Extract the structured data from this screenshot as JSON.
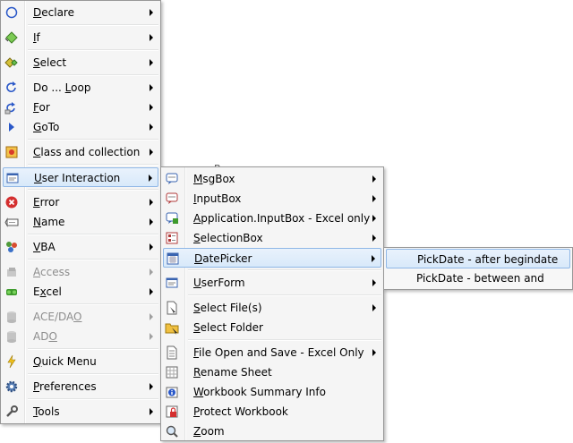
{
  "main_menu": {
    "items": [
      {
        "label": "Declare",
        "mnemonic": "D",
        "rest": "eclare",
        "icon": "circle-icon"
      },
      {
        "label": "If",
        "mnemonic": "I",
        "rest": "f",
        "icon": "diamond-green-icon"
      },
      {
        "label": "Select",
        "mnemonic": "S",
        "rest": "elect",
        "icon": "diamond-yellow-icon"
      },
      {
        "label": "Do ... Loop",
        "pre": "Do ... ",
        "mnemonic": "L",
        "rest": "oop",
        "icon": "loop-icon"
      },
      {
        "label": "For",
        "mnemonic": "F",
        "rest": "or",
        "icon": "for-loop-icon"
      },
      {
        "label": "GoTo",
        "mnemonic": "G",
        "rest": "oTo",
        "icon": "play-arrow-icon"
      },
      {
        "label": "Class and collection",
        "mnemonic": "C",
        "rest": "lass and collection",
        "icon": "class-icon"
      },
      {
        "label": "User Interaction",
        "mnemonic": "U",
        "rest": "ser Interaction",
        "icon": "form-icon"
      },
      {
        "label": "Error",
        "mnemonic": "E",
        "rest": "rror",
        "icon": "error-icon"
      },
      {
        "label": "Name",
        "mnemonic": "N",
        "rest": "ame",
        "icon": "name-tag-icon"
      },
      {
        "label": "VBA",
        "mnemonic": "V",
        "rest": "BA",
        "icon": "vba-icon"
      },
      {
        "label": "Access",
        "mnemonic": "A",
        "rest": "ccess",
        "icon": "access-icon"
      },
      {
        "label": "Excel",
        "mnemonic": "x",
        "pre": "E",
        "rest": "cel",
        "icon": "excel-icon"
      },
      {
        "label": "ACE/DAO",
        "pre": "ACE/DA",
        "mnemonic": "O",
        "rest": "",
        "icon": "database-icon"
      },
      {
        "label": "ADO",
        "pre": "AD",
        "mnemonic": "O",
        "rest": "",
        "icon": "database-icon"
      },
      {
        "label": "Quick Menu",
        "mnemonic": "Q",
        "rest": "uick Menu",
        "icon": "lightning-icon"
      },
      {
        "label": "Preferences",
        "mnemonic": "P",
        "rest": "references",
        "icon": "gear-icon"
      },
      {
        "label": "Tools",
        "mnemonic": "T",
        "rest": "ools",
        "icon": "wrench-icon"
      }
    ]
  },
  "submenu_user_interaction": {
    "items": [
      {
        "label": "MsgBox",
        "mnemonic": "M",
        "rest": "sgBox",
        "icon": "message-box-icon"
      },
      {
        "label": "InputBox",
        "mnemonic": "I",
        "rest": "nputBox",
        "icon": "input-box-icon"
      },
      {
        "label": "Application.InputBox - Excel only",
        "mnemonic": "A",
        "rest": "pplication.InputBox - Excel only",
        "icon": "app-input-box-icon"
      },
      {
        "label": "SelectionBox",
        "mnemonic": "S",
        "rest": "electionBox",
        "icon": "selection-box-icon"
      },
      {
        "label": "DatePicker",
        "mnemonic": "D",
        "rest": "atePicker",
        "icon": "calendar-icon"
      },
      {
        "label": "UserForm",
        "mnemonic": "U",
        "rest": "serForm",
        "icon": "userform-icon"
      },
      {
        "label": "Select File(s)",
        "mnemonic": "S",
        "rest": "elect File(s)",
        "icon": "file-icon"
      },
      {
        "label": "Select Folder",
        "mnemonic": "S",
        "rest": "elect Folder",
        "icon": "folder-icon"
      },
      {
        "label": "File Open and Save - Excel Only",
        "mnemonic": "F",
        "rest": "ile Open and Save - Excel Only",
        "icon": "file-open-icon"
      },
      {
        "label": "Rename Sheet",
        "mnemonic": "R",
        "rest": "ename Sheet",
        "icon": "sheet-icon"
      },
      {
        "label": "Workbook Summary Info",
        "mnemonic": "W",
        "rest": "orkbook Summary Info",
        "icon": "info-icon"
      },
      {
        "label": "Protect Workbook",
        "mnemonic": "P",
        "rest": "rotect Workbook",
        "icon": "protect-icon"
      },
      {
        "label": "Zoom",
        "mnemonic": "Z",
        "rest": "oom",
        "icon": "zoom-icon"
      }
    ]
  },
  "submenu_datepicker": {
    "items": [
      {
        "label": "PickDate - after begindate"
      },
      {
        "label": "PickDate - between and"
      }
    ]
  },
  "ghost_text": "gBox",
  "colors": {
    "highlight_border": "#8fb7e6",
    "highlight_fill": "#dbeafb",
    "disabled_text": "#8d8d8d",
    "menu_bg": "#f5f5f5"
  }
}
